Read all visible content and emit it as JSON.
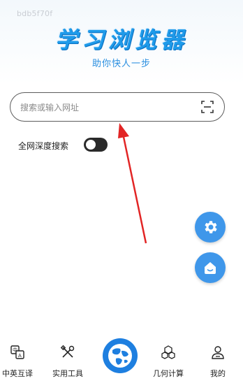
{
  "header": {
    "watermark": "bdb5f70f",
    "title": "学习浏览器",
    "slogan": "助你快人一步"
  },
  "search": {
    "placeholder": "搜索或输入网址",
    "value": ""
  },
  "deep_search": {
    "label": "全网深度搜索",
    "enabled": false
  },
  "fabs": [
    {
      "icon": "gear-icon"
    },
    {
      "icon": "home-icon"
    }
  ],
  "bottom_nav": [
    {
      "label": "中英互译",
      "icon": "translate-icon"
    },
    {
      "label": "实用工具",
      "icon": "tools-icon"
    },
    {
      "label": "",
      "icon": "globe-icon"
    },
    {
      "label": "几何计算",
      "icon": "geometry-icon"
    },
    {
      "label": "我的",
      "icon": "user-icon"
    }
  ],
  "colors": {
    "brand": "#1f9bea",
    "fab": "#3f97ea",
    "center_nav": "#1e7fe0",
    "annotation_arrow": "#e22525"
  }
}
